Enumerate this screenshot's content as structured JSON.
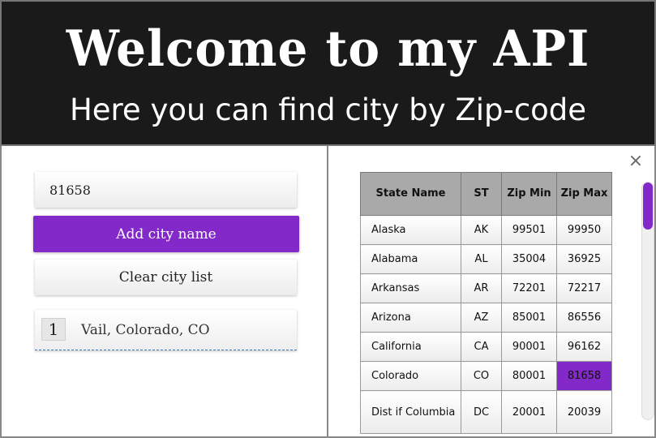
{
  "header": {
    "title": "Welcome to my API",
    "subtitle": "Here you can find city by Zip-code"
  },
  "form": {
    "zip_value": "81658",
    "add_button_label": "Add city name",
    "clear_button_label": "Clear city list"
  },
  "city_list": [
    {
      "index": "1",
      "name": "Vail, Colorado, CO"
    }
  ],
  "table": {
    "headers": {
      "state": "State Name",
      "st": "ST",
      "zip_min": "Zip Min",
      "zip_max": "Zip Max"
    },
    "rows": [
      {
        "state": "Alaska",
        "st": "AK",
        "zip_min": "99501",
        "zip_max": "99950"
      },
      {
        "state": "Alabama",
        "st": "AL",
        "zip_min": "35004",
        "zip_max": "36925"
      },
      {
        "state": "Arkansas",
        "st": "AR",
        "zip_min": "72201",
        "zip_max": "72217"
      },
      {
        "state": "Arizona",
        "st": "AZ",
        "zip_min": "85001",
        "zip_max": "86556"
      },
      {
        "state": "California",
        "st": "CA",
        "zip_min": "90001",
        "zip_max": "96162"
      },
      {
        "state": "Colorado",
        "st": "CO",
        "zip_min": "80001",
        "zip_max": "81658",
        "highlight": true
      },
      {
        "state": "Dist if Columbia",
        "st": "DC",
        "zip_min": "20001",
        "zip_max": "20039"
      }
    ]
  },
  "icons": {
    "close": "close-icon"
  },
  "colors": {
    "accent": "#8429c9",
    "header_bg": "#1a1a1a",
    "table_header_bg": "#a9a9a9"
  }
}
